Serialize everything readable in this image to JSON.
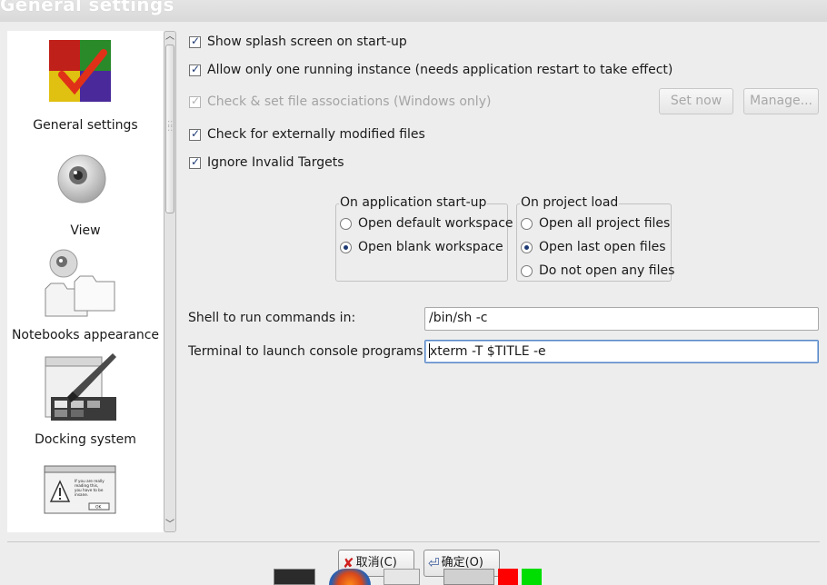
{
  "window": {
    "title": "General settings"
  },
  "sidebar": {
    "items": [
      {
        "label": "General settings",
        "icon": "general-settings-icon"
      },
      {
        "label": "View",
        "icon": "view-eye-icon"
      },
      {
        "label": "Notebooks appearance",
        "icon": "notebooks-appearance-icon"
      },
      {
        "label": "Docking system",
        "icon": "docking-system-icon"
      },
      {
        "label": "",
        "icon": "dialog-warning-icon"
      }
    ],
    "dialog_icon_text": "If you are really reading this, you have to be insane.",
    "dialog_icon_ok": "OK"
  },
  "options": {
    "splash": "Show splash screen on start-up",
    "single_instance": "Allow only one running instance (needs application restart to take effect)",
    "file_assoc": "Check & set file associations (Windows only)",
    "set_now": "Set now",
    "manage": "Manage...",
    "external_modified": "Check for externally modified files",
    "ignore_invalid": "Ignore Invalid Targets"
  },
  "startup_group": {
    "title": "On application start-up",
    "options": [
      "Open default workspace",
      "Open blank workspace"
    ],
    "selected": 1
  },
  "project_group": {
    "title": "On project load",
    "options": [
      "Open all project files",
      "Open last open files",
      "Do not open any files"
    ],
    "selected": 1
  },
  "shell": {
    "label": "Shell to run commands in:",
    "value": "/bin/sh -c"
  },
  "terminal": {
    "label": "Terminal to launch console programs:",
    "value": "xterm -T $TITLE -e"
  },
  "dialog": {
    "cancel": "取消(C)",
    "ok": "确定(O)"
  }
}
